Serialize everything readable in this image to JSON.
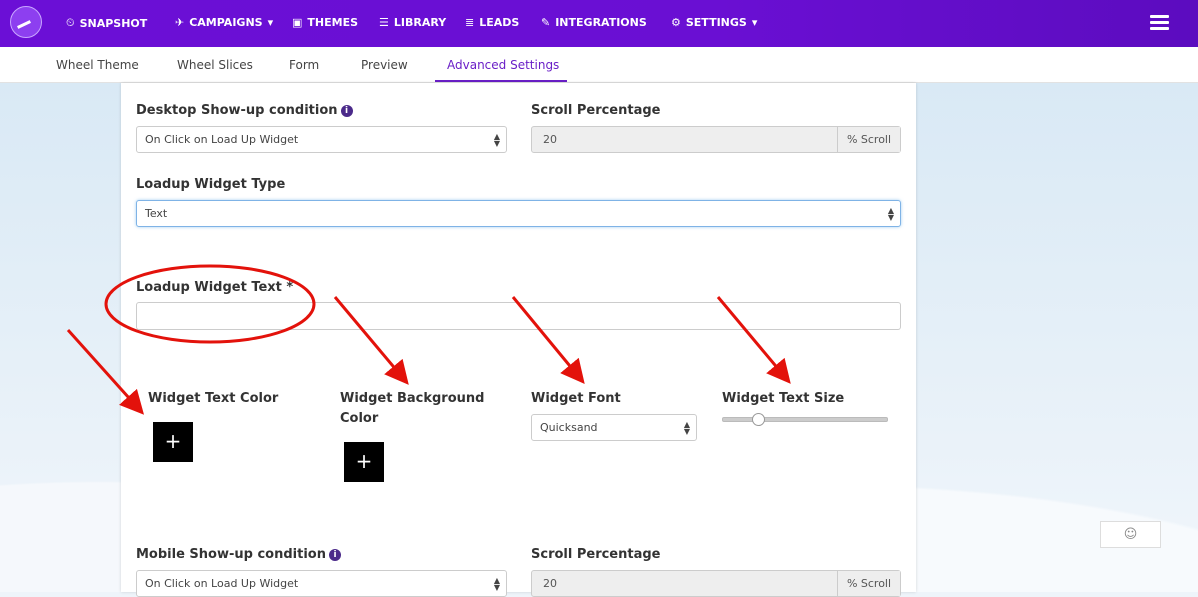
{
  "nav": {
    "items": [
      {
        "key": "snapshot",
        "label": "SNAPSHOT",
        "icon": "⏲"
      },
      {
        "key": "campaigns",
        "label": "CAMPAIGNS",
        "icon": "✈",
        "caret": "▾"
      },
      {
        "key": "themes",
        "label": "THEMES",
        "icon": "▣"
      },
      {
        "key": "library",
        "label": "LIBRARY",
        "icon": "☰"
      },
      {
        "key": "leads",
        "label": "LEADS",
        "icon": "≣"
      },
      {
        "key": "integrations",
        "label": "INTEGRATIONS",
        "icon": "✎"
      },
      {
        "key": "settings",
        "label": "SETTINGS",
        "icon": "⚙",
        "caret": "▾"
      }
    ]
  },
  "tabs": [
    {
      "label": "Wheel Theme"
    },
    {
      "label": "Wheel Slices"
    },
    {
      "label": "Form"
    },
    {
      "label": "Preview"
    },
    {
      "label": "Advanced Settings",
      "active": true
    }
  ],
  "desktop": {
    "condition_label": "Desktop Show-up condition",
    "condition_value": "On Click on Load Up Widget",
    "scroll_label": "Scroll Percentage",
    "scroll_value": "20",
    "scroll_unit": "% Scroll"
  },
  "widget": {
    "type_label": "Loadup Widget Type",
    "type_value": "Text",
    "text_label": "Loadup Widget Text *",
    "text_value": "",
    "text_color_label": "Widget Text Color",
    "bg_color_label_1": "Widget Background",
    "bg_color_label_2": "Color",
    "font_label": "Widget Font",
    "font_value": "Quicksand",
    "size_label": "Widget Text Size",
    "size_level": 0.22,
    "plus": "+"
  },
  "mobile": {
    "condition_label": "Mobile Show-up condition",
    "condition_value": "On Click on Load Up Widget",
    "scroll_label": "Scroll Percentage",
    "scroll_value": "20",
    "scroll_unit": "% Scroll"
  },
  "info_glyph": "i",
  "select_arrows": "▲▼",
  "emoji_widget": "☺",
  "colors": {
    "accent": "#6a1fc7",
    "annotation": "#e3120b"
  }
}
